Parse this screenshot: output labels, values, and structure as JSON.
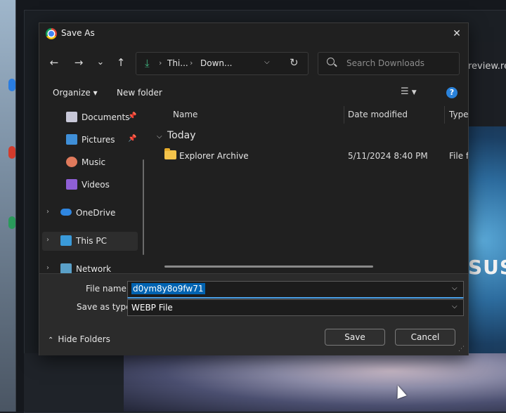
{
  "background": {
    "url_fragment": "review.re",
    "brand_fragment": "SUS"
  },
  "dialog": {
    "title": "Save As",
    "icons": {
      "app": "chrome-icon",
      "close": "close-icon"
    }
  },
  "nav": {
    "back": "←",
    "forward": "→",
    "recent": "⌄",
    "up": "↑",
    "address": {
      "part1": "Thi...",
      "part2": "Down..."
    },
    "search_placeholder": "Search Downloads"
  },
  "command_bar": {
    "organize": "Organize ▾",
    "new_folder": "New folder"
  },
  "sidebar": {
    "items": [
      {
        "label": "Documents",
        "icon": "documents-icon",
        "pinned": true
      },
      {
        "label": "Pictures",
        "icon": "pictures-icon",
        "pinned": true
      },
      {
        "label": "Music",
        "icon": "music-icon",
        "pinned": false
      },
      {
        "label": "Videos",
        "icon": "videos-icon",
        "pinned": false
      },
      {
        "label": "OneDrive",
        "icon": "onedrive-icon",
        "pinned": false
      },
      {
        "label": "This PC",
        "icon": "this-pc-icon",
        "pinned": false,
        "selected": true
      },
      {
        "label": "Network",
        "icon": "network-icon",
        "pinned": false
      }
    ]
  },
  "file_list": {
    "columns": [
      "Name",
      "Date modified",
      "Type"
    ],
    "group": "Today",
    "rows": [
      {
        "name": "Explorer Archive",
        "date": "5/11/2024 8:40 PM",
        "type": "File fo"
      }
    ]
  },
  "form": {
    "file_name_label": "File name:",
    "file_name_value": "d0ym8y8o9fw71",
    "save_type_label": "Save as type:",
    "save_type_value": "WEBP File"
  },
  "footer": {
    "hide_folders": "Hide Folders",
    "save": "Save",
    "cancel": "Cancel"
  }
}
